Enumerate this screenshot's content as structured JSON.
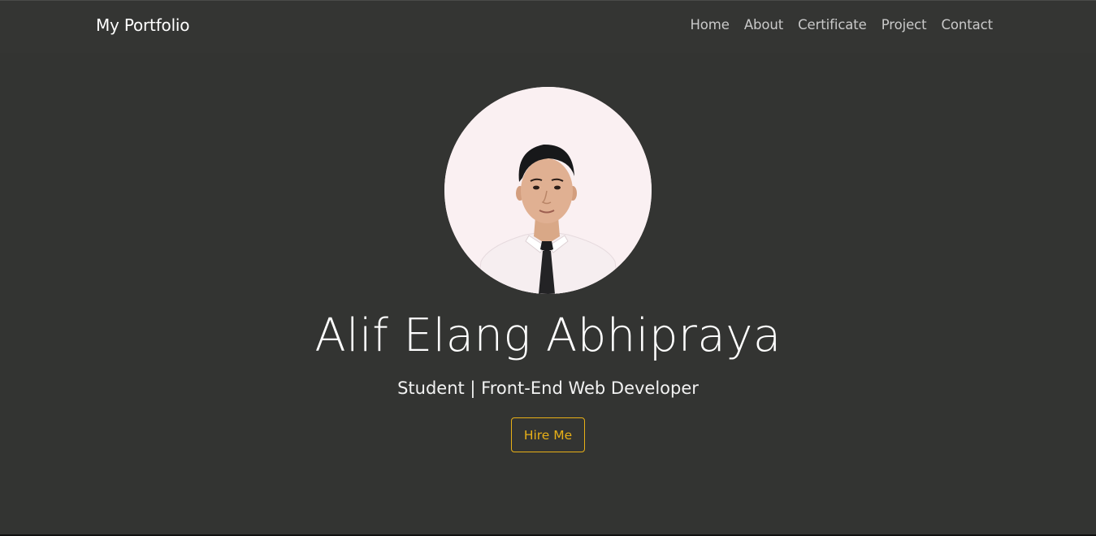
{
  "navbar": {
    "brand": "My Portfolio",
    "links": [
      "Home",
      "About",
      "Certificate",
      "Project",
      "Contact"
    ]
  },
  "hero": {
    "name": "Alif Elang Abhipraya",
    "tagline": "Student | Front-End Web Developer",
    "cta_label": "Hire Me"
  },
  "colors": {
    "background": "#333432",
    "accent": "#e8b017",
    "nav_text": "#c9c9c9",
    "text": "#ffffff"
  }
}
